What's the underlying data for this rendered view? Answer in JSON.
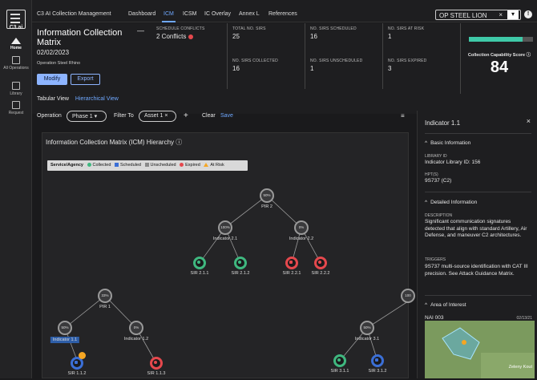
{
  "nav": {
    "logo": "C3.ai",
    "items": [
      {
        "label": "Home",
        "icon": "home-icon"
      },
      {
        "label": "All Operations",
        "icon": "document-icon"
      },
      {
        "label": "Library",
        "icon": "library-icon"
      },
      {
        "label": "Request",
        "icon": "list-icon"
      }
    ]
  },
  "topbar": {
    "app_title": "C3 AI Collection Management",
    "tabs": [
      "Dashboard",
      "ICM",
      "ICSM",
      "IC Overlay",
      "Annex L",
      "References"
    ],
    "active_tab": "ICM",
    "operation": "OP STEEL LION"
  },
  "header": {
    "title": "Information Collection Matrix",
    "date": "02/02/2023",
    "operation": "Operation Steel Rhino",
    "modify_label": "Modify",
    "export_label": "Export",
    "view_tabs": [
      "Tabular View",
      "Hierarchical View"
    ],
    "active_view": "Hierarchical View",
    "stats": [
      {
        "label": "SCHEDULE CONFLICTS",
        "value": "2 Conflicts"
      },
      {
        "label": "TOTAL NO. SIRS",
        "value": "25"
      },
      {
        "label": "NO. SIRS SCHEDULED",
        "value": "16"
      },
      {
        "label": "NO. SIRS AT RISK",
        "value": "1"
      },
      {
        "label": "NO. SIRS COLLECTED",
        "value": "16"
      },
      {
        "label": "NO. SIRS UNSCHEDULED",
        "value": "1"
      },
      {
        "label": "NO. SIRS EXPIRED",
        "value": "3"
      }
    ],
    "capability_label": "Collection Capability Score",
    "capability_score": "84",
    "capability_fraction": 0.84
  },
  "filters": {
    "operation_label": "Operation",
    "operation_value": "Phase 1",
    "filter_label": "Filter To",
    "filter_value": "Asset 1",
    "clear_label": "Clear",
    "save_label": "Save"
  },
  "matrix": {
    "title": "Information Collection Matrix (ICM) Hierarchy",
    "legend_title": "Service/Agency",
    "legend": [
      {
        "label": "Collected",
        "color": "#3fb87f"
      },
      {
        "label": "Scheduled",
        "color": "#3b6fd6"
      },
      {
        "label": "Unscheduled",
        "color": "#8a8a8a"
      },
      {
        "label": "Expired",
        "color": "#e5484d"
      },
      {
        "label": "At Risk",
        "color": "#f5a623"
      }
    ],
    "nodes": [
      {
        "id": "pir2",
        "label": "PIR 2",
        "pct": "50%"
      },
      {
        "id": "ind21",
        "label": "Indicator 2.1",
        "pct": "100%"
      },
      {
        "id": "ind22",
        "label": "Indicator 2.2",
        "pct": "0%"
      },
      {
        "id": "sir211",
        "label": "SIR 2.1.1"
      },
      {
        "id": "sir212",
        "label": "SIR 2.1.2"
      },
      {
        "id": "sir221",
        "label": "SIR 2.2.1"
      },
      {
        "id": "sir222",
        "label": "SIR 2.2.2"
      },
      {
        "id": "pir1",
        "label": "PIR 1",
        "pct": "33%"
      },
      {
        "id": "ind11",
        "label": "Indicator 1.1",
        "pct": "50%"
      },
      {
        "id": "ind12",
        "label": "Indicator 1.2",
        "pct": "0%"
      },
      {
        "id": "sir112",
        "label": "SIR 1.1.2"
      },
      {
        "id": "sir113",
        "label": "SIR 1.1.3"
      },
      {
        "id": "ind31",
        "label": "Indicator 3.1",
        "pct": "50%"
      },
      {
        "id": "sir311",
        "label": "SIR 3.1.1"
      },
      {
        "id": "sir312",
        "label": "SIR 3.1.2"
      },
      {
        "id": "pir3",
        "label": "",
        "pct": "100"
      }
    ]
  },
  "panel": {
    "title": "Indicator 1.1",
    "basic_label": "Basic Information",
    "library_id_label": "LIBRARY ID",
    "library_id": "Indicator Library ID: 156",
    "hpt_label": "HPT(S)",
    "hpt": "9S737 (C2)",
    "detailed_label": "Detailed Information",
    "description_label": "DESCRIPTION",
    "description": "Significant communication signatures detected that align with standard Artillery, Air Defense, and maneuver C2 architectures.",
    "triggers_label": "TRIGGERS",
    "triggers": "9S737 multi-source identification with CAT III precision. See Attack Guidance Matrix.",
    "area_label": "Area of Interest",
    "area_name": "NAI 003",
    "area_date": "02/13/21",
    "map_place": "Zeleny Kout"
  }
}
